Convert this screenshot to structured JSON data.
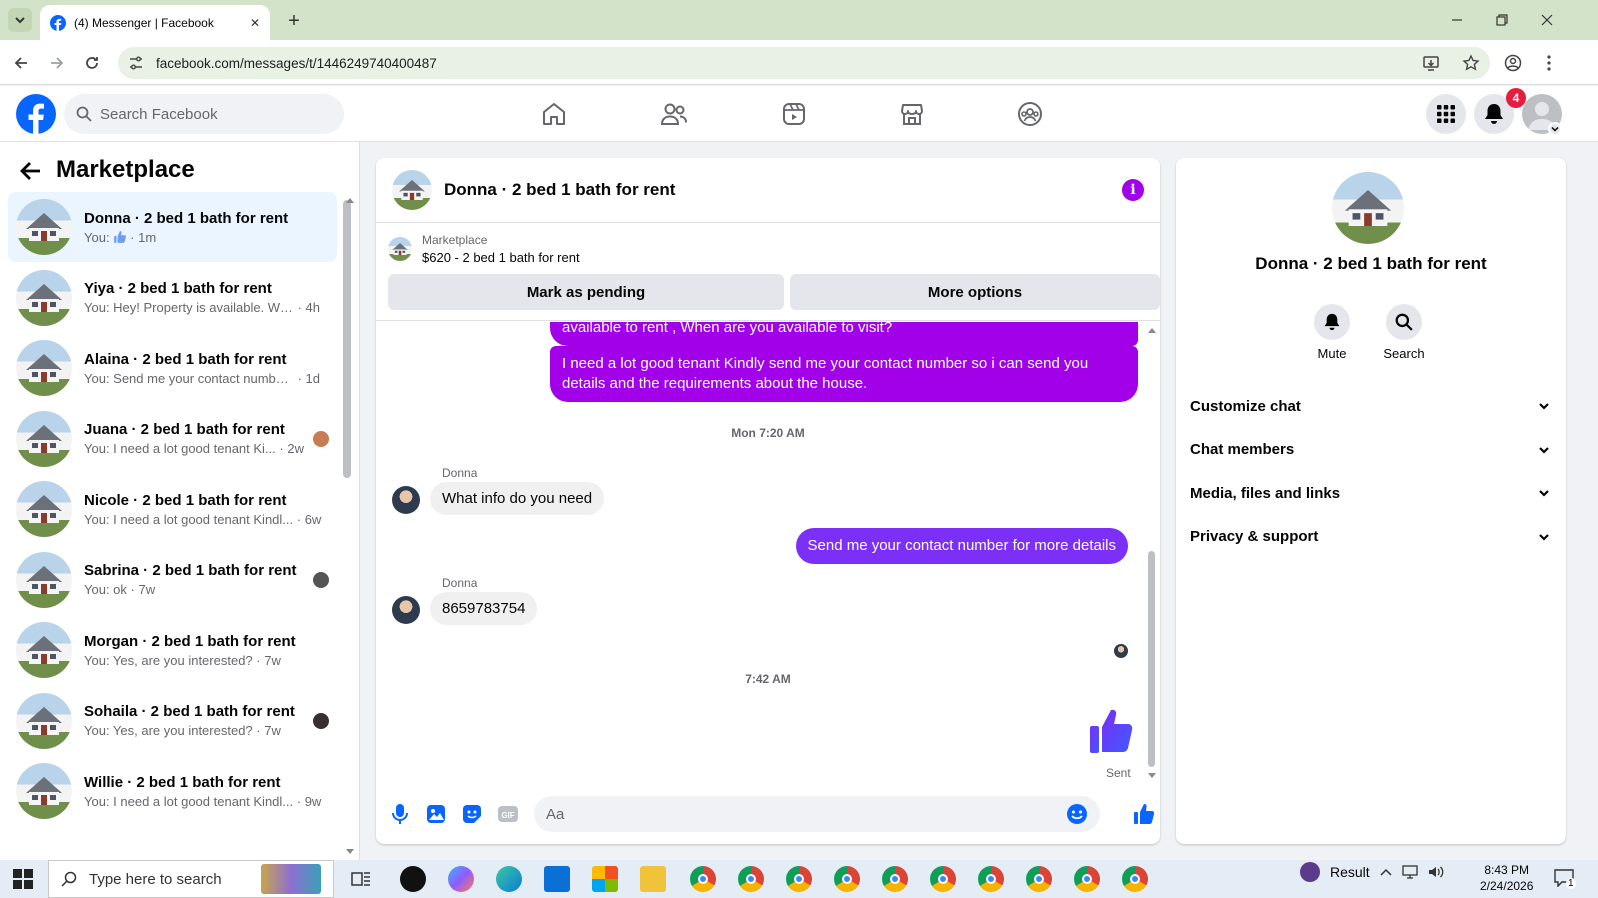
{
  "browser": {
    "tab_title": "(4) Messenger | Facebook",
    "url": "facebook.com/messages/t/1446249740400487",
    "new_tab": "+",
    "close_tab": "✕"
  },
  "header": {
    "search_placeholder": "Search Facebook",
    "notification_count": "4",
    "nav_icons": [
      "home-icon",
      "friends-icon",
      "video-icon",
      "marketplace-icon",
      "groups-icon"
    ]
  },
  "sidebar": {
    "title": "Marketplace",
    "conversations": [
      {
        "name": "Donna · 2 bed 1 bath for rent",
        "preview": "You:",
        "time": " · 1m",
        "like": true,
        "active": true
      },
      {
        "name": "Yiya · 2 bed 1 bath for rent",
        "preview": "You: Hey! Property is available. Wo...",
        "time": " · 4h"
      },
      {
        "name": "Alaina · 2 bed 1 bath for rent",
        "preview": "You: Send me your contact number...",
        "time": " · 1d"
      },
      {
        "name": "Juana · 2 bed 1 bath for rent",
        "preview": "You: I need a lot good tenant Ki...",
        "time": " · 2w"
      },
      {
        "name": "Nicole · 2 bed 1 bath for rent",
        "preview": "You: I need a lot good tenant Kindl...",
        "time": " · 6w"
      },
      {
        "name": "Sabrina · 2 bed 1 bath for rent",
        "preview": "You: ok",
        "time": " · 7w"
      },
      {
        "name": "Morgan · 2 bed 1 bath for rent",
        "preview": "You: Yes, are you interested?",
        "time": " · 7w"
      },
      {
        "name": "Sohaila · 2 bed 1 bath for rent",
        "preview": "You: Yes, are you interested?",
        "time": " · 7w"
      },
      {
        "name": "Willie · 2 bed 1 bath for rent",
        "preview": "You: I need a lot good tenant Kindl...",
        "time": " · 9w"
      }
    ]
  },
  "chat": {
    "title": "Donna · 2 bed 1 bath for rent",
    "marketplace_label": "Marketplace",
    "listing": "$620 - 2 bed 1 bath for rent",
    "mark_pending": "Mark as pending",
    "more_options": "More options",
    "messages": {
      "out1": "available to rent , When are you available to visit?",
      "out2": "I need a lot good tenant Kindly send me your contact number so i can send you details and the requirements about the house.",
      "stamp1": "Mon 7:20 AM",
      "sender1": "Donna",
      "in1": "What info do you need",
      "out3": "Send me your contact number for more details",
      "sender2": "Donna",
      "in2": "8659783754",
      "stamp2": "7:42 AM",
      "sent": "Sent"
    },
    "composer_placeholder": "Aa"
  },
  "details": {
    "name": "Donna · 2 bed 1 bath for rent",
    "mute": "Mute",
    "search": "Search",
    "sections": [
      "Customize chat",
      "Chat members",
      "Media, files and links",
      "Privacy & support"
    ]
  },
  "taskbar": {
    "search_placeholder": "Type here to search",
    "weather": "Result",
    "time": "8:43 PM",
    "date": "2/24/2026",
    "notif": "1"
  },
  "colors": {
    "accent": "#a100e8",
    "fb_blue": "#0866ff"
  }
}
